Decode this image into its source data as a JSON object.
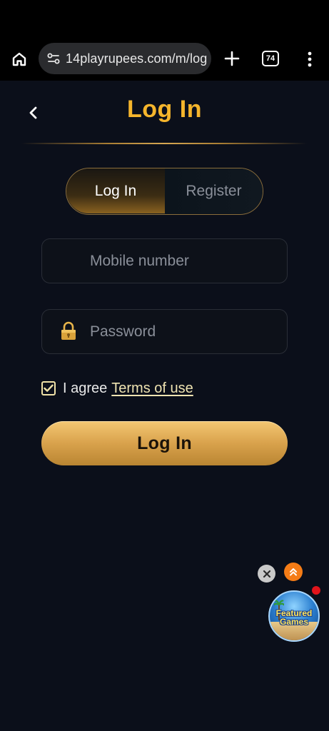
{
  "browser": {
    "url": "14playrupees.com/m/log",
    "tab_count": "74",
    "icons": {
      "home": "home-icon",
      "site_settings": "tune-icon",
      "new_tab": "plus-icon",
      "menu": "more-vert-icon"
    }
  },
  "header": {
    "title": "Log In",
    "back_icon": "chevron-left-icon"
  },
  "tabs": {
    "login_label": "Log In",
    "register_label": "Register",
    "active": "Log In"
  },
  "form": {
    "mobile_placeholder": "Mobile number",
    "mobile_value": "",
    "password_placeholder": "Password",
    "password_value": "",
    "password_icon": "lock-icon",
    "agree_text": "I agree",
    "terms_label": "Terms of use",
    "agree_checked": true,
    "submit_label": "Log In"
  },
  "floating_widget": {
    "close_icon": "close-icon",
    "scroll_icon": "double-chevron-up-icon",
    "badge_text_line1": "Featured",
    "badge_text_line2": "Games"
  },
  "colors": {
    "background": "#0b0f1a",
    "accent_gold": "#f5b52c",
    "button_gold": "#d9a24c",
    "scroll_orange": "#f57c16",
    "notification_red": "#e1141b"
  }
}
